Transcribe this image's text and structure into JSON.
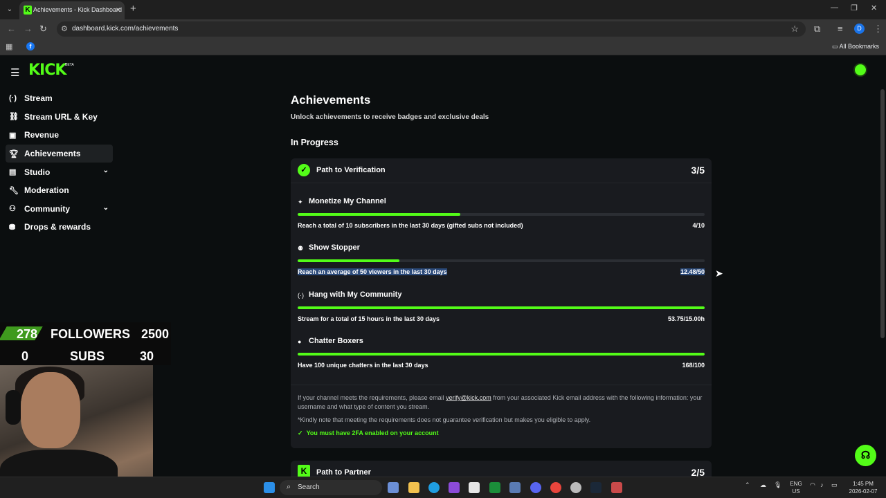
{
  "browser": {
    "tab_title": "Achievements - Kick Dashboard",
    "tab_favicon": "K",
    "url": "dashboard.kick.com/achievements",
    "profile_initial": "D",
    "bookmarks_all": "All Bookmarks"
  },
  "app": {
    "logo": "KICK",
    "logo_badge": "BETA",
    "accent_color": "#53fc18"
  },
  "sidebar": {
    "items": [
      {
        "label": "Stream",
        "icon": "broadcast-icon"
      },
      {
        "label": "Stream URL & Key",
        "icon": "link-icon"
      },
      {
        "label": "Revenue",
        "icon": "revenue-icon"
      },
      {
        "label": "Achievements",
        "icon": "trophy-icon",
        "active": true
      },
      {
        "label": "Studio",
        "icon": "studio-icon",
        "expandable": true
      },
      {
        "label": "Moderation",
        "icon": "wrench-icon"
      },
      {
        "label": "Community",
        "icon": "community-icon",
        "expandable": true
      },
      {
        "label": "Drops & rewards",
        "icon": "gift-icon"
      }
    ]
  },
  "main": {
    "title": "Achievements",
    "subtitle": "Unlock achievements to receive badges and exclusive deals",
    "section_in_progress": "In Progress",
    "verification": {
      "title": "Path to Verification",
      "count": "3/5",
      "achievements": [
        {
          "title": "Monetize My Channel",
          "icon": "sparkle-icon",
          "description": "Reach a total of 10 subscribers in the last 30 days (gifted subs not included)",
          "value": "4/10",
          "progress": 0.4
        },
        {
          "title": "Show Stopper",
          "icon": "users-icon",
          "description": "Reach an average of 50 viewers in the last 30 days",
          "value": "12.48/50",
          "progress": 0.25
        },
        {
          "title": "Hang with My Community",
          "icon": "broadcast-icon",
          "description": "Stream for a total of 15 hours in the last 30 days",
          "value": "53.75/15.00h",
          "progress": 1.0
        },
        {
          "title": "Chatter Boxers",
          "icon": "chat-icon",
          "description": "Have 100 unique chatters in the last 30 days",
          "value": "168/100",
          "progress": 1.0
        }
      ],
      "note_prefix": "If your channel meets the requirements, please email ",
      "note_email": "verify@kick.com",
      "note_suffix": " from your associated Kick email address with the following information: your username and what type of content you stream.",
      "note2": "*Kindly note that meeting the requirements does not guarantee verification but makes you eligible to apply.",
      "requirement": "You must have 2FA enabled on your account"
    },
    "partner": {
      "title": "Path to Partner",
      "count": "2/5"
    }
  },
  "overlay": {
    "followers_count": "278",
    "followers_label": "FOLLOWERS",
    "followers_goal": "2500",
    "subs_count": "0",
    "subs_label": "SUBS",
    "subs_goal": "30"
  },
  "taskbar": {
    "search_label": "Search",
    "lang_top": "ENG",
    "lang_bottom": "US",
    "time": "1:45 PM",
    "date": "2026-02-07"
  }
}
